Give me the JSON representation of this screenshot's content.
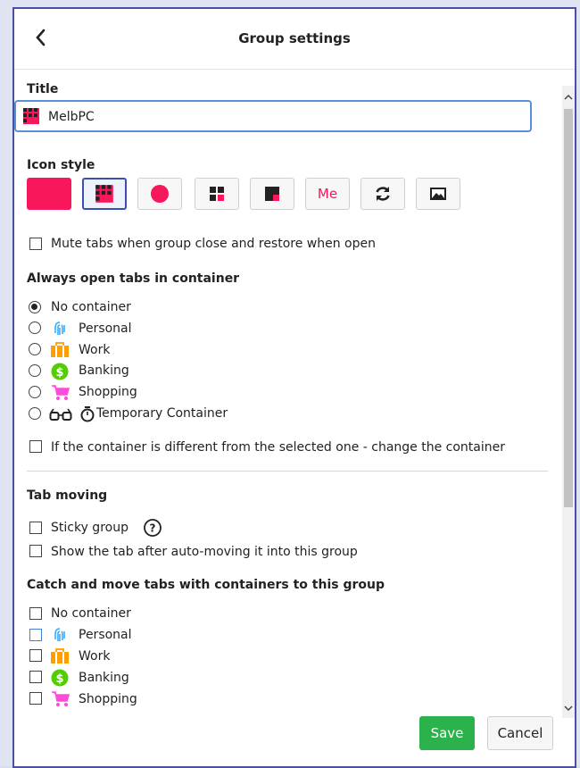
{
  "header": {
    "title": "Group settings",
    "back_icon": "chevron-left-icon"
  },
  "title_section": {
    "label": "Title",
    "value": "MelbPC"
  },
  "icon_style": {
    "label": "Icon style",
    "options": [
      {
        "name": "solid-color-icon"
      },
      {
        "name": "squares-grid-icon",
        "selected": true
      },
      {
        "name": "circle-icon"
      },
      {
        "name": "four-squares-icon"
      },
      {
        "name": "corner-square-icon"
      },
      {
        "name": "title-letters-icon",
        "text": "Me"
      },
      {
        "name": "refresh-icon"
      },
      {
        "name": "image-icon"
      }
    ],
    "accent": "#f7175a"
  },
  "mute_tabs": {
    "label": "Mute tabs when group close and restore when open",
    "checked": false
  },
  "always_open": {
    "label": "Always open tabs in container",
    "options": [
      {
        "label": "No container",
        "checked": true
      },
      {
        "label": "Personal",
        "icon": "fingerprint-icon",
        "color": "#37adff"
      },
      {
        "label": "Work",
        "icon": "briefcase-icon",
        "color": "#ff9f00"
      },
      {
        "label": "Banking",
        "icon": "dollar-icon",
        "color": "#51cd00"
      },
      {
        "label": "Shopping",
        "icon": "cart-icon",
        "color": "#ff4bda"
      },
      {
        "label": "Temporary Container",
        "icon": "glasses-icon"
      }
    ],
    "change_container": {
      "label": "If the container is different from the selected one - change the container",
      "checked": false
    }
  },
  "tab_moving": {
    "label": "Tab moving",
    "sticky": {
      "label": "Sticky group",
      "help_icon": "question-icon"
    },
    "show_tab": {
      "label": "Show the tab after auto-moving it into this group"
    }
  },
  "catch_move": {
    "label": "Catch and move tabs with containers to this group",
    "options": [
      {
        "label": "No container"
      },
      {
        "label": "Personal"
      },
      {
        "label": "Work"
      },
      {
        "label": "Banking"
      },
      {
        "label": "Shopping"
      }
    ]
  },
  "footer": {
    "save_label": "Save",
    "cancel_label": "Cancel"
  }
}
